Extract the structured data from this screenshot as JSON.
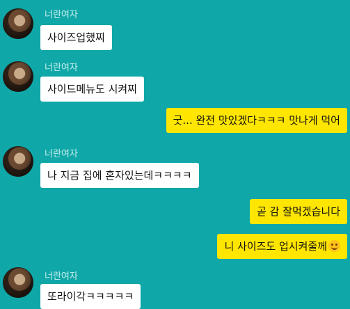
{
  "chat": {
    "messages": [
      {
        "sender": "너란여자",
        "text": "사이즈업했찌"
      },
      {
        "sender": "너란여자",
        "text": "사이드메뉴도 시켜찌"
      },
      {
        "text": "굿... 완전 맛있겠다ㅋㅋㅋ 맛나게 먹어"
      },
      {
        "sender": "너란여자",
        "text": "나 지금 집에 혼자있는데ㅋㅋㅋㅋ"
      },
      {
        "text": "곧 감 잘먹겠습니다"
      },
      {
        "text": "니 사이즈도 업시켜줄께",
        "emoji": "smiling-face-icon"
      },
      {
        "sender": "너란여자",
        "text": "또라이각ㅋㅋㅋㅋㅋ"
      }
    ]
  }
}
